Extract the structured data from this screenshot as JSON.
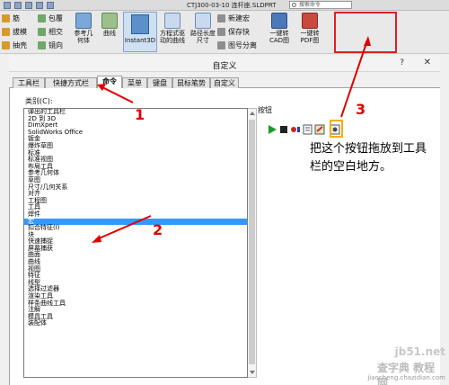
{
  "app": {
    "title": "CTJ300-03-10 连杆座.SLDPRT",
    "search_placeholder": "搜索命令"
  },
  "ribbon": {
    "col1": [
      "筋",
      "拔模",
      "抽壳"
    ],
    "col2": [
      "包覆",
      "相交",
      "镜向"
    ],
    "ref_geom": "参考几何体",
    "curves": "曲线",
    "instant3d": "Instant3D",
    "vary_sketch": "方程式驱动的曲线",
    "path_length": "路径长度尺寸",
    "new_macro": "新建宏",
    "save_version": "保存快",
    "split": "图号分离",
    "cad_to": "一键转CAD图",
    "pdf_to": "一键转PDF图"
  },
  "dialog": {
    "title": "自定义",
    "help": "?",
    "close": "✕"
  },
  "tabs": [
    {
      "label": "工具栏"
    },
    {
      "label": "快捷方式栏"
    },
    {
      "label": "命令"
    },
    {
      "label": "菜单"
    },
    {
      "label": "键盘"
    },
    {
      "label": "鼠标笔势"
    },
    {
      "label": "自定义"
    }
  ],
  "category_label": "类别(C):",
  "categories": [
    "弹出的工具栏",
    "2D 到 3D",
    "DimXpert",
    "SolidWorks Office",
    "钣金",
    "爆炸草图",
    "标准",
    "标准视图",
    "布局工具",
    "参考几何体",
    "草图",
    "尺寸/几何关系",
    "对齐",
    "工程图",
    "工具",
    "焊件",
    "宏",
    "扣合特征(I)",
    "块",
    "快速捕捉",
    "屏幕捕获",
    "曲面",
    "曲线",
    "视图",
    "特征",
    "线型",
    "选择过滤器",
    "渲染工具",
    "样条曲线工具",
    "注解",
    "模具工具",
    "装配体"
  ],
  "selected_category_index": 16,
  "buttons_label": "按钮",
  "button_icons": [
    "play-icon",
    "stop-icon",
    "record-icon",
    "new-macro-icon",
    "edit-macro-icon",
    "custom-command-icon",
    "macro-button-icon"
  ],
  "instruction": "把这个按钮拖放到工具栏的空白地方。",
  "steps": [
    "1",
    "2",
    "3"
  ],
  "watermark": {
    "line1": "jb51.net",
    "line2": "查字典 教程网",
    "line3": "jiaocheng.chazidian.com"
  },
  "colors": {
    "annotation": "#e00000",
    "selection": "#3399ff",
    "highlight": "#f0b000"
  }
}
